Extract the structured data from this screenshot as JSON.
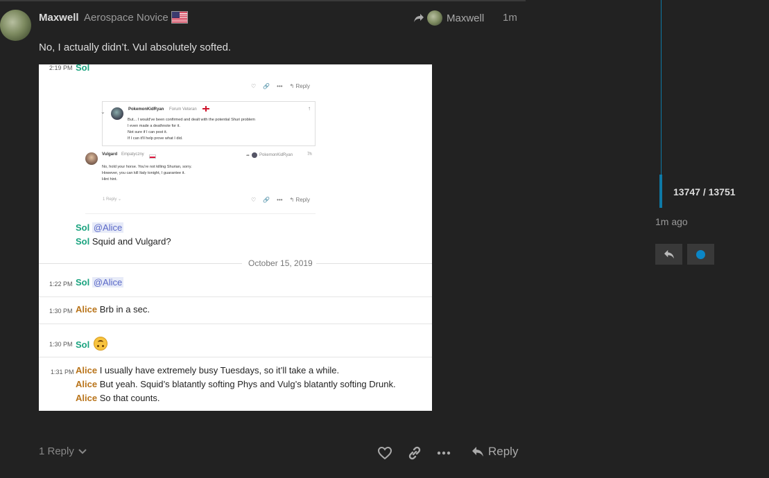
{
  "post": {
    "username": "Maxwell",
    "user_title": "Aerospace Novice",
    "reply_to_name": "Maxwell",
    "age": "1m",
    "text": "No, I actually didn’t. Vul absolutely softed.",
    "replies_label": "1 Reply",
    "reply_label": "Reply"
  },
  "embed": {
    "rows": [
      {
        "time": "2:19 PM",
        "author": "Sol"
      },
      {
        "author": "Sol",
        "mention": "@Alice"
      },
      {
        "author": "Sol",
        "text": "Squid and Vulgard?"
      },
      {
        "time": "1:22 PM",
        "author": "Sol",
        "mention": "@Alice"
      },
      {
        "time": "1:30 PM",
        "author": "Alice",
        "text": "Brb in a sec."
      },
      {
        "time": "1:30 PM",
        "author": "Sol"
      },
      {
        "time": "1:31 PM",
        "author": "Alice",
        "text": "I usually have extremely busy Tuesdays, so it’ll take a while."
      },
      {
        "author": "Alice",
        "text": "But yeah. Squid’s blatantly softing Phys and Vulg’s blatantly softing Drunk."
      },
      {
        "author": "Alice",
        "text": "So that counts."
      }
    ],
    "date_divider": "October 15, 2019",
    "inner_reply_label": "Reply",
    "quote": {
      "name": "PokemonKidRyan",
      "title": "Forum Veteran",
      "lines": [
        "But... I would've been confirmed and dealt with the potential Shuri problem",
        "I even made a deathnote for it.",
        "Not sure if I can post it.",
        "If I can it'll help prove what I did."
      ]
    },
    "vul": {
      "name": "Vulgard",
      "title": "Empatyczny",
      "reply_to": "PokemonKidRyan",
      "age": "7h",
      "lines": [
        "No, hold your horse. You're not killing Shurian, sorry.",
        "However, you can kill Italy tonight, I guarantee it.",
        "Hint hint."
      ],
      "replies": "1 Reply"
    }
  },
  "timeline": {
    "position": "13747 / 13751",
    "age": "1m ago",
    "track_fraction": 0.9997
  },
  "colors": {
    "background": "#222222",
    "accent": "#0b86c6",
    "sol": "#1aa37f",
    "alice": "#b9741a"
  }
}
